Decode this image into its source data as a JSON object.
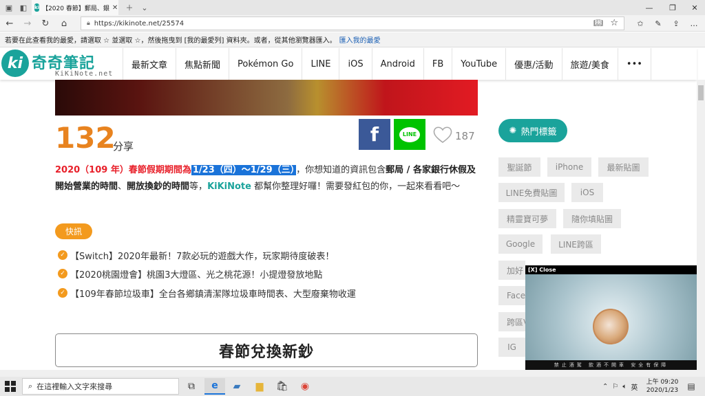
{
  "browser": {
    "tab_title": "【2020 春節】郵局、銀",
    "url": "https://kikinote.net/25574",
    "favorites_bar_text": "若要在此查看我的最愛，請選取 ☆ 並選取 ☆，然後拖曳到 [我的最愛列] 資料夾。或者，從其他瀏覽器匯入。",
    "import_link": "匯入我的最愛"
  },
  "site": {
    "logo_mark": "ki",
    "logo_name": "奇奇筆記",
    "logo_sub": "KiKiNote.net",
    "nav": [
      "最新文章",
      "焦點新聞",
      "Pokémon Go",
      "LINE",
      "iOS",
      "Android",
      "FB",
      "YouTube",
      "優惠/活動",
      "旅遊/美食",
      "•••"
    ]
  },
  "article": {
    "share_count": "132",
    "share_label": "分享",
    "fb_label": "f",
    "line_label": "LINE",
    "like_count": "187",
    "intro": {
      "p1_red": "2020（109 年）春節假期期間為",
      "p1_highlight": "1/23（四）～1/29（三）",
      "p1_a": "，你想知道的資訊包含",
      "p1_b1": "郵局 / 各家銀行休假及開始營業的時間",
      "p1_c": "、",
      "p1_b2": "開放換鈔的時間",
      "p1_d": "等，",
      "p1_teal": "KiKiNote",
      "p1_e": " 都幫你整理好囉！需要發紅包的你，一起來看看吧～"
    },
    "news_badge": "快訊",
    "news_items": [
      "【Switch】2020年最新！7款必玩的遊戲大作，玩家期待度破表！",
      "【2020桃園燈會】桃園3大燈區、光之桃花源！小提燈發放地點",
      "【109年春節垃圾車】全台各鄉鎮清潔隊垃圾車時間表、大型廢棄物收運"
    ],
    "section_title": "春節兌換新鈔"
  },
  "sidebar": {
    "hot_tags_label": "熱門標籤",
    "tags": [
      "聖誕節",
      "iPhone",
      "最新貼圖",
      "LINE免費貼圖",
      "iOS",
      "精靈寶可夢",
      "隨你填貼圖",
      "Google",
      "LINE跨區",
      "加好",
      "",
      "",
      "Faceb",
      "跨區V",
      "IG"
    ]
  },
  "video": {
    "close_label": "[X] Close",
    "caption": "禁止酒駕 飲酒不開車 安全有保障"
  },
  "taskbar": {
    "search_placeholder": "在這裡輸入文字來搜尋",
    "time": "上午 09:20",
    "date": "2020/1/23"
  },
  "colors": {
    "brand_teal": "#1aa39b",
    "accent_orange": "#e8831f",
    "highlight_blue": "#1a73d9",
    "facebook": "#3b5998",
    "line": "#00c300"
  }
}
